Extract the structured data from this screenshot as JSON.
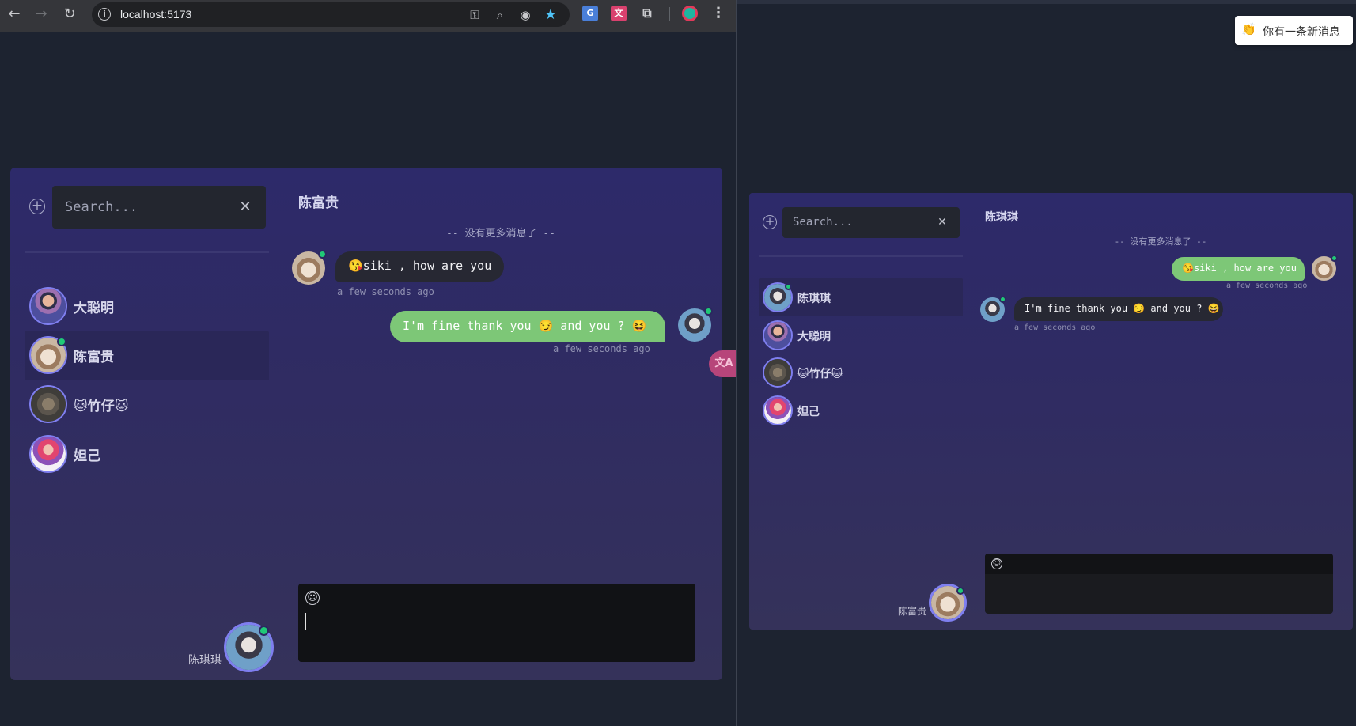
{
  "browser": {
    "url": "localhost:5173",
    "nav": {
      "back": "←",
      "forward": "→",
      "reload": "↻",
      "info": "i"
    },
    "omnibox_icons": [
      "key-icon",
      "zoom-icon",
      "eye-icon",
      "star-icon"
    ],
    "extensions": [
      "google-translate-icon",
      "translate-extension-icon",
      "puzzle-icon",
      "profile-icon",
      "menu-icon"
    ]
  },
  "left_window": {
    "search": {
      "placeholder": "Search..."
    },
    "contacts": [
      {
        "name": "大聪明",
        "active": false,
        "online": false
      },
      {
        "name": "陈富贵",
        "active": true,
        "online": true
      },
      {
        "name": "🐱竹仔🐱",
        "active": false,
        "online": false
      },
      {
        "name": "妲己",
        "active": false,
        "online": false
      }
    ],
    "current_user": "陈琪琪",
    "chat": {
      "title": "陈富贵",
      "no_more": "-- 没有更多消息了 --",
      "messages": [
        {
          "side": "left",
          "text": "😘siki , how are you",
          "time": "a few seconds ago"
        },
        {
          "side": "right",
          "text": "I'm fine thank you 😏 and you ? 😆",
          "time": "a few seconds ago"
        }
      ]
    },
    "translate_fab": "文A"
  },
  "right_window": {
    "toast": {
      "icon": "👏",
      "text": "你有一条新消息"
    },
    "search": {
      "placeholder": "Search..."
    },
    "contacts": [
      {
        "name": "陈琪琪",
        "active": true,
        "online": true
      },
      {
        "name": "大聪明",
        "active": false,
        "online": false
      },
      {
        "name": "🐱竹仔🐱",
        "active": false,
        "online": false
      },
      {
        "name": "妲己",
        "active": false,
        "online": false
      }
    ],
    "current_user": "陈富贵",
    "chat": {
      "title": "陈琪琪",
      "no_more": "-- 没有更多消息了 --",
      "messages": [
        {
          "side": "right",
          "text": "😘siki , how are you",
          "time": "a few seconds ago"
        },
        {
          "side": "left",
          "text": "I'm fine thank you 😏 and you ? 😆",
          "time": "a few seconds ago"
        }
      ]
    }
  },
  "symbols": {
    "add": "+",
    "clear": "✕",
    "emoji": "☺"
  },
  "colors": {
    "online": "#20c977",
    "bubble_dark": "#272833",
    "bubble_green": "#7dc777",
    "accent": "#7f7ff0"
  }
}
